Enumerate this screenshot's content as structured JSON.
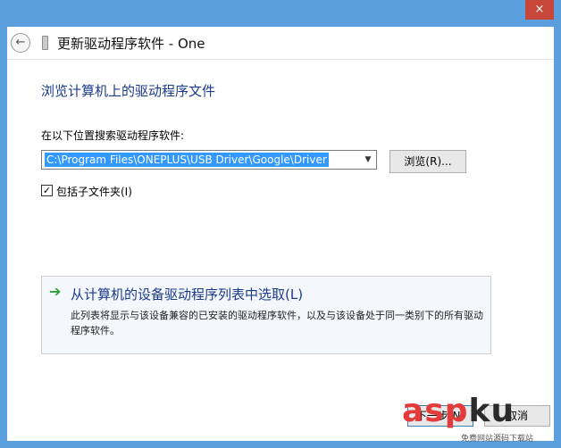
{
  "titlebar": {
    "close_glyph": "×"
  },
  "header": {
    "back_glyph": "←",
    "title": "更新驱动程序软件 - One"
  },
  "page": {
    "heading": "浏览计算机上的驱动程序文件",
    "search_label": "在以下位置搜索驱动程序软件:",
    "path_value": "C:\\Program Files\\ONEPLUS\\USB Driver\\Google\\Driver",
    "browse_label": "浏览(R)...",
    "include_subfolders_label": "包括子文件夹(I)",
    "include_subfolders_checked": true,
    "checkmark_glyph": "✓"
  },
  "pick_list": {
    "icon": "green-arrow-icon",
    "arrow_glyph": "➔",
    "title": "从计算机的设备驱动程序列表中选取(L)",
    "description": "此列表将显示与该设备兼容的已安装的驱动程序软件，以及与该设备处于同一类别下的所有驱动程序软件。"
  },
  "footer": {
    "next_label": "下一步(N)",
    "cancel_label": "取消"
  },
  "watermark": {
    "main": "asp",
    "suffix": "ku",
    "sub": "免费网站源码下载站"
  },
  "colors": {
    "frame": "#5b9fde",
    "heading": "#1a3a8b",
    "selection": "#3399ff",
    "close": "#c7483b"
  }
}
